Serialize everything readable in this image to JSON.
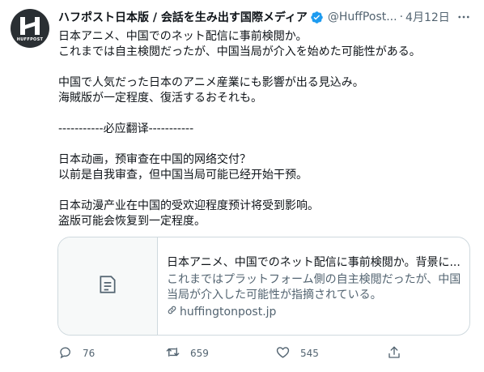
{
  "account": {
    "display_name": "ハフポスト日本版 / 会話を生み出す国際メディア",
    "handle": "@HuffPost...",
    "separator": "·",
    "timestamp": "4月12日",
    "avatar_word": "HUFFPOST"
  },
  "tweet": {
    "lines": [
      "日本アニメ、中国でのネット配信に事前検閲か。",
      "これまでは自主検閲だったが、中国当局が介入を始めた可能性がある。",
      "",
      "中国で人気だった日本のアニメ産業にも影響が出る見込み。",
      "海賊版が一定程度、復活するおそれも。",
      "",
      "-----------必应翻译-----------",
      "",
      "日本动画，预审查在中国的网络交付？",
      "以前是自我审查，但中国当局可能已经开始干预。",
      "",
      "日本动漫产业在中国的受欢迎程度预计将受到影响。",
      "盗版可能会恢复到一定程度。"
    ]
  },
  "card": {
    "title": "日本アニメ、中国でのネット配信に事前検閲か。背景に...",
    "description": "これまではプラットフォーム側の自主検閲だったが、中国当局が介入した可能性が指摘されている。",
    "domain": "huffingtonpost.jp",
    "thumb_icon": "article-icon"
  },
  "actions": {
    "reply_count": "76",
    "retweet_count": "659",
    "like_count": "545"
  },
  "colors": {
    "text_primary": "#0f1419",
    "text_secondary": "#536471",
    "verified_blue": "#1d9bf0",
    "border": "#cfd9de",
    "avatar_bg": "#2a2f33"
  }
}
